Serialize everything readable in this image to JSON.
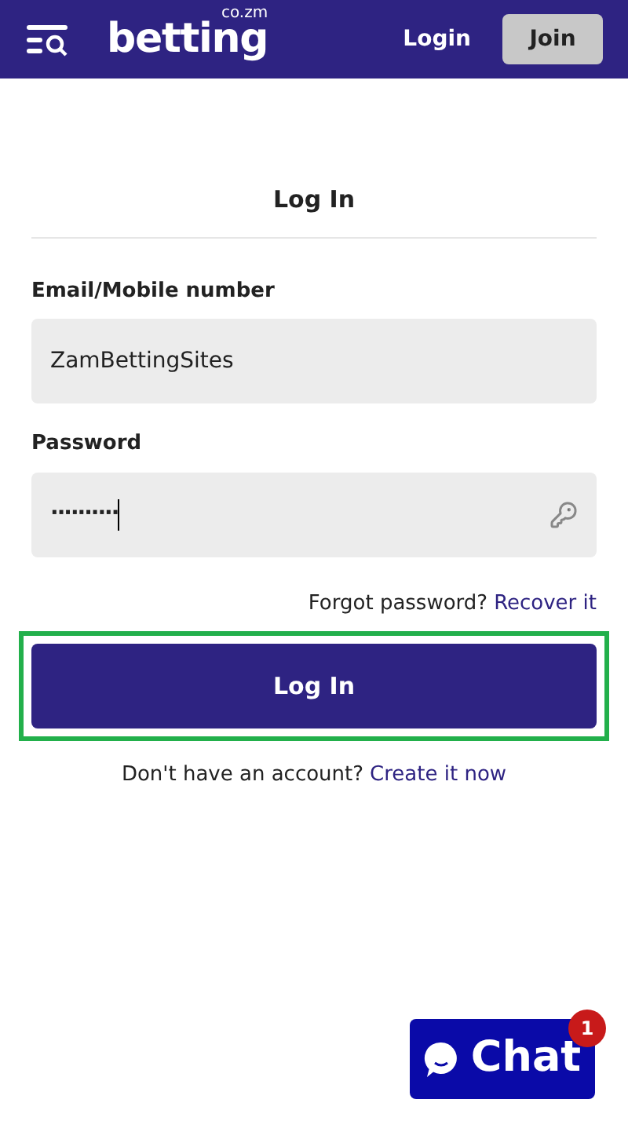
{
  "header": {
    "logo": {
      "name": "betting",
      "suffix": "co.zm"
    },
    "login_link": "Login",
    "join_button": "Join"
  },
  "form": {
    "title": "Log In",
    "fields": [
      {
        "kind": "text",
        "label": "Email/Mobile number",
        "value": "ZamBettingSites"
      },
      {
        "kind": "password",
        "label": "Password",
        "value": "··········",
        "focused": true
      }
    ],
    "forgot": {
      "text": "Forgot password?",
      "link": "Recover it"
    },
    "submit": {
      "label": "Log In",
      "highlighted": true
    },
    "signup": {
      "text": "Don't have an account?",
      "link": "Create it now"
    }
  },
  "chat": {
    "label": "Chat",
    "badge": "1"
  }
}
